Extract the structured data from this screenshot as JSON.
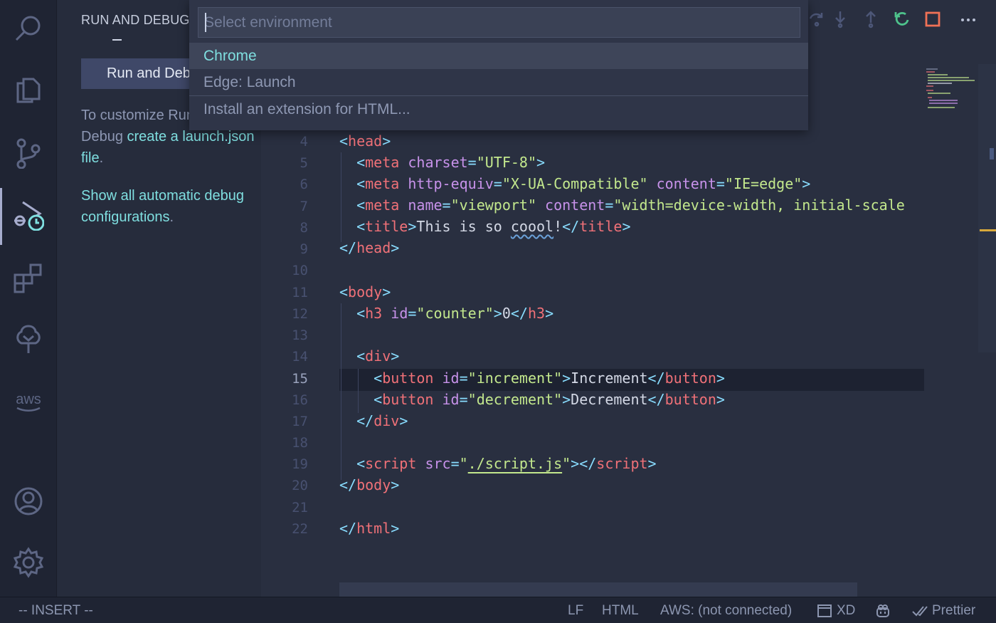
{
  "colors": {
    "accent_cyan": "#7fdfe0",
    "tag": "#f07178",
    "bracket": "#89ddff",
    "attribute": "#c792ea",
    "string": "#c3e88d",
    "restart_green": "#4ec38c",
    "stop_orange": "#f07156"
  },
  "activity_bar": {
    "icons": [
      "search-icon",
      "files-icon",
      "source-control-icon",
      "run-debug-icon",
      "extensions-icon",
      "tree-icon",
      "aws-icon",
      "account-icon",
      "gear-icon"
    ],
    "aws_label": "aws"
  },
  "sidebar": {
    "title": "RUN AND DEBUG:",
    "run_button": "Run and Debug",
    "customize_prefix": "To customize Run and",
    "customize_debug": "Debug",
    "customize_link": "create a launch.json file",
    "customize_suffix": ".",
    "show_link": "Show all automatic debug configurations",
    "show_suffix": "."
  },
  "quick_pick": {
    "placeholder": "Select environment",
    "items": [
      {
        "label": "Chrome",
        "selected": true
      },
      {
        "label": "Edge: Launch",
        "selected": false
      },
      {
        "label": "Install an extension for HTML...",
        "selected": false
      }
    ]
  },
  "editor": {
    "current_line": 15,
    "line_numbers": [
      "4",
      "5",
      "6",
      "7",
      "8",
      "9",
      "10",
      "11",
      "12",
      "13",
      "14",
      "15",
      "16",
      "17",
      "18",
      "19",
      "20",
      "21",
      "22"
    ],
    "code": {
      "l4": {
        "tag": "head"
      },
      "l5": {
        "tag": "meta",
        "attr1": "charset",
        "val1": "\"UTF-8\""
      },
      "l6": {
        "tag": "meta",
        "attr1": "http-equiv",
        "val1": "\"X-UA-Compatible\"",
        "attr2": "content",
        "val2": "\"IE=edge\""
      },
      "l7": {
        "tag": "meta",
        "attr1": "name",
        "val1": "\"viewport\"",
        "attr2": "content",
        "val2": "\"width=device-width, initial-scale"
      },
      "l8": {
        "tag": "title",
        "text1": "This is so ",
        "text2": "coool",
        "text3": "!"
      },
      "l9": {
        "tag": "head"
      },
      "l11": {
        "tag": "body"
      },
      "l12": {
        "tag": "h3",
        "attr1": "id",
        "val1": "\"counter\"",
        "text": "0"
      },
      "l14": {
        "tag": "div"
      },
      "l15": {
        "tag": "button",
        "attr1": "id",
        "val1": "\"increment\"",
        "text": "Increment"
      },
      "l16": {
        "tag": "button",
        "attr1": "id",
        "val1": "\"decrement\"",
        "text": "Decrement"
      },
      "l17": {
        "tag": "div"
      },
      "l19": {
        "tag": "script",
        "attr1": "src",
        "q": "\"",
        "val1": "./script.js"
      },
      "l20": {
        "tag": "body"
      },
      "l22": {
        "tag": "html"
      }
    }
  },
  "debug_toolbar": {
    "icons": [
      "step-over-icon",
      "step-into-icon",
      "step-out-icon",
      "restart-icon",
      "stop-icon",
      "more-icon"
    ]
  },
  "status_bar": {
    "mode": "-- INSERT --",
    "eol": "LF",
    "language": "HTML",
    "aws": "AWS: (not connected)",
    "xd": "XD",
    "prettier": "Prettier"
  }
}
